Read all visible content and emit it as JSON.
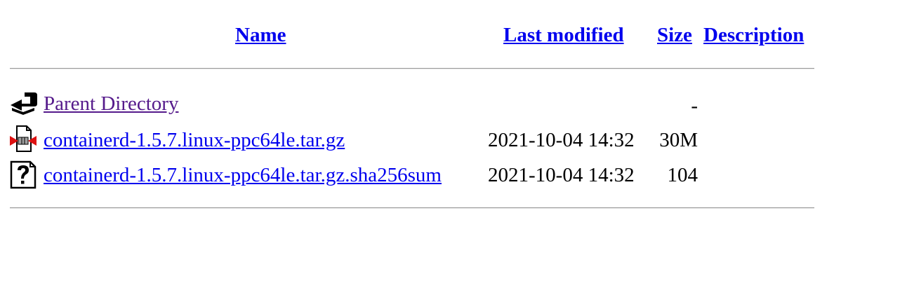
{
  "headers": {
    "name": "Name",
    "last_modified": "Last modified",
    "size": "Size",
    "description": "Description"
  },
  "rows": [
    {
      "icon": "back-arrow-icon",
      "name": "Parent Directory",
      "last_modified": "",
      "size": "-",
      "description": "",
      "visited": true
    },
    {
      "icon": "compressed-archive-icon",
      "name": "containerd-1.5.7.linux-ppc64le.tar.gz",
      "last_modified": "2021-10-04 14:32",
      "size": "30M",
      "description": "",
      "visited": false
    },
    {
      "icon": "unknown-file-icon",
      "name": "containerd-1.5.7.linux-ppc64le.tar.gz.sha256sum",
      "last_modified": "2021-10-04 14:32",
      "size": "104",
      "description": "",
      "visited": false
    }
  ],
  "colors": {
    "link": "#0000ee",
    "visited_link": "#551a8b",
    "rule": "#9a9a9a"
  }
}
